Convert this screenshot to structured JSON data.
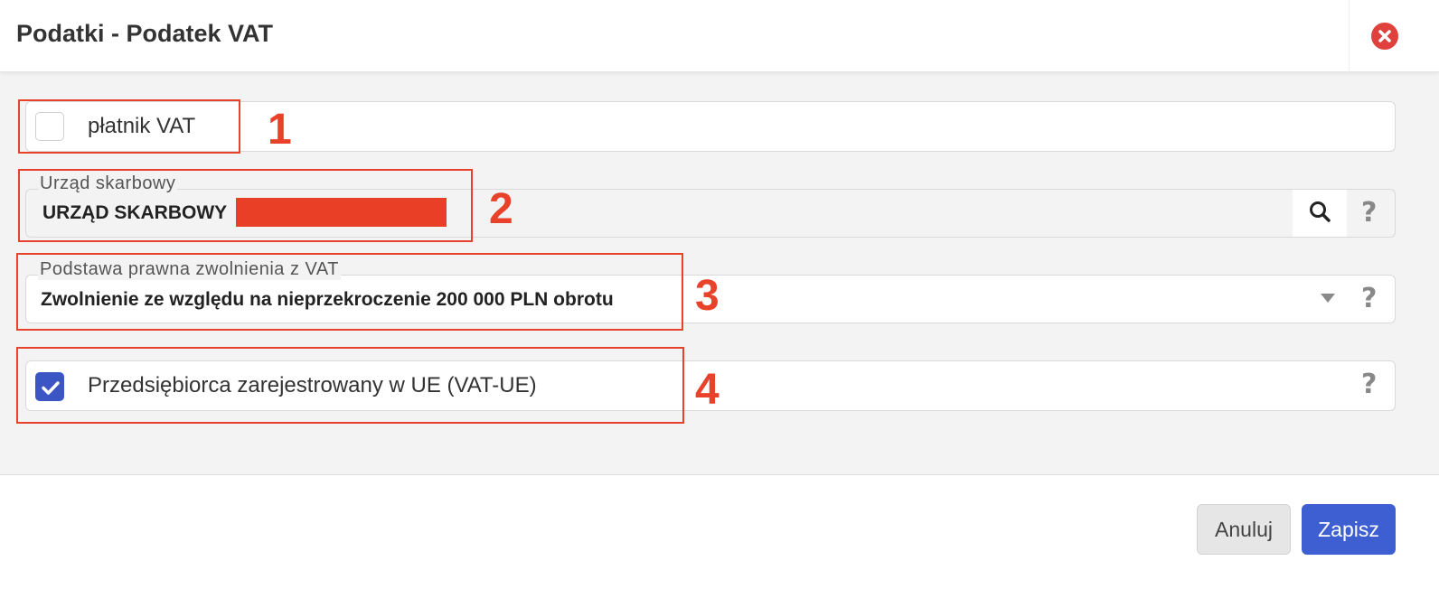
{
  "dialog": {
    "title": "Podatki - Podatek VAT"
  },
  "fields": {
    "vat_payer": {
      "label": "płatnik VAT",
      "checked": false
    },
    "tax_office": {
      "legend": "Urząd skarbowy",
      "value": "URZĄD SKARBOWY"
    },
    "exemption_basis": {
      "legend": "Podstawa prawna zwolnienia z VAT",
      "value": "Zwolnienie ze względu na nieprzekroczenie 200 000 PLN obrotu"
    },
    "eu_registered": {
      "label": "Przedsiębiorca zarejestrowany w UE (VAT-UE)",
      "checked": true
    }
  },
  "help_symbol": "?",
  "annotations": [
    "1",
    "2",
    "3",
    "4"
  ],
  "buttons": {
    "cancel": "Anuluj",
    "save": "Zapisz"
  },
  "icons": {
    "close": "close-circle-icon",
    "search": "search-icon",
    "dropdown": "caret-down-icon",
    "help": "question-mark-icon",
    "check": "checkmark-icon"
  },
  "colors": {
    "accent": "#3e5fd1",
    "close": "#e0413d",
    "annotation": "#e8422a"
  }
}
